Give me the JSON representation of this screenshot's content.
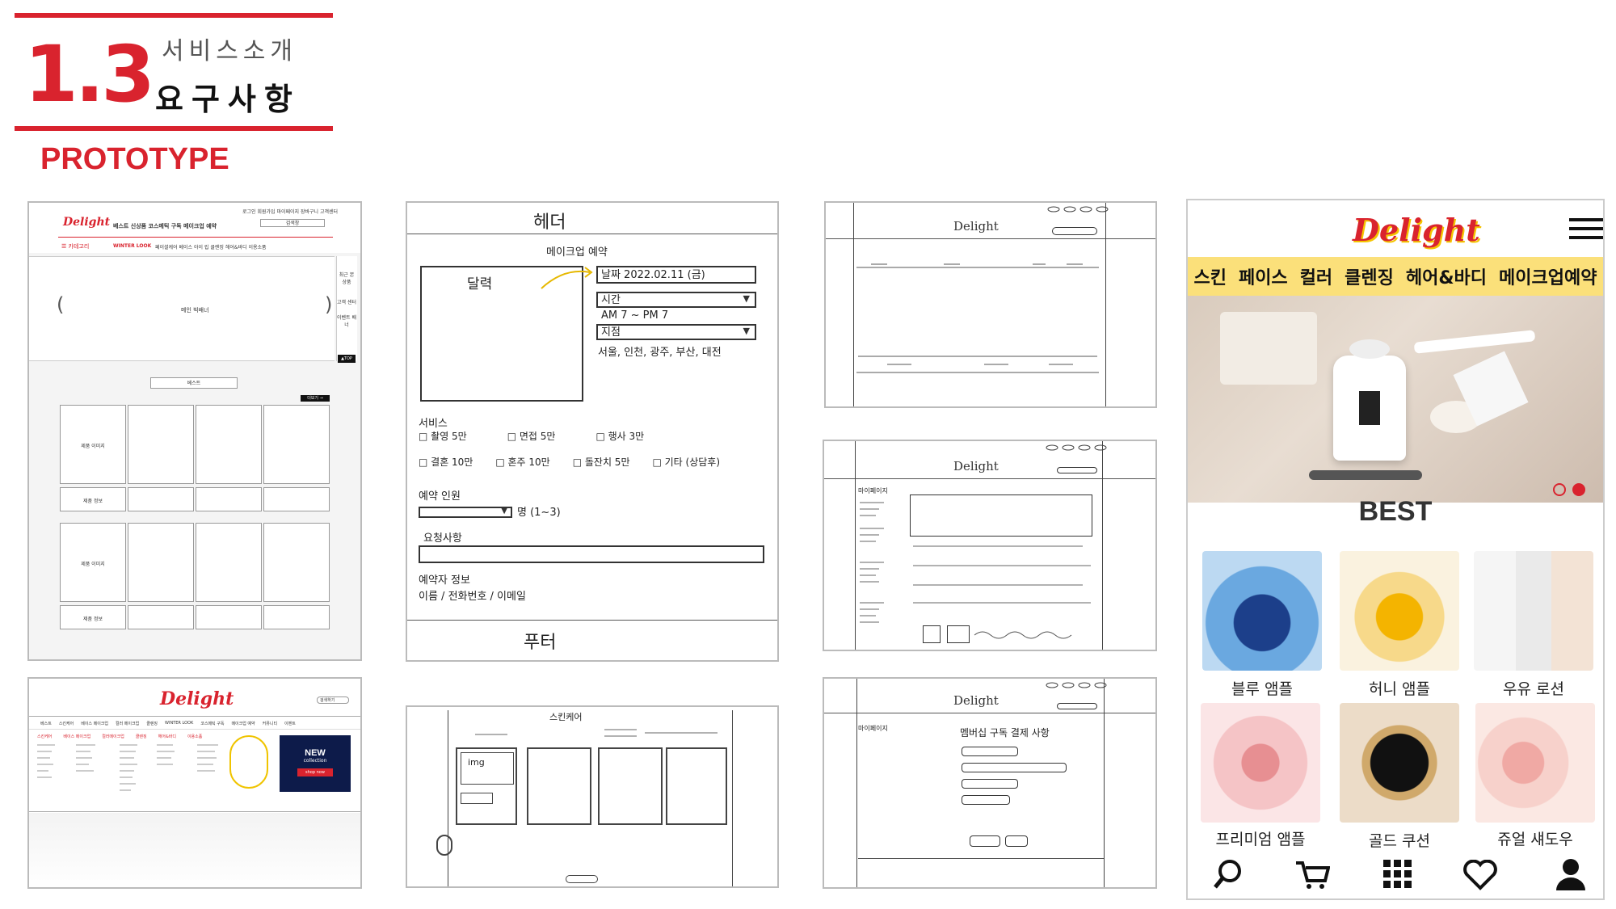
{
  "header": {
    "section_number": "1.3",
    "subtitle": "서비스소개",
    "title": "요구사항",
    "label": "PROTOTYPE"
  },
  "colors": {
    "accent": "#d9232e",
    "banner_yellow": "#fbe07a"
  },
  "desktop_main": {
    "logo": "Delight",
    "top_links": "로그인 회원가입 마이페이지 장바구니 고객센터",
    "nav": "베스트  신상품  코스메틱 구독  메이크업 예약",
    "search_label": "검색창",
    "category_label": "카테고리",
    "sub_nav_first": "WINTER LOOK",
    "sub_nav": "페이셜케어 베이스 아이 립 클렌징 헤어&바디 이용소품",
    "banner": "메인 빅배너",
    "side_items": [
      "최근 본 상품",
      "고객 센터",
      "이벤트 배너"
    ],
    "top_button": "▲TOP",
    "best_label": "베스트",
    "more_label": "더보기 →",
    "product_image": "제품 이미지",
    "product_info": "제품 정보"
  },
  "desktop_menu": {
    "logo": "Delight",
    "search_placeholder": "검색하기",
    "nav": [
      "베스트",
      "스킨케어",
      "베이스 메이크업",
      "컬러 메이크업",
      "클렌징",
      "WINTER LOOK",
      "코스메틱 구독",
      "메이크업 예약",
      "커뮤니티",
      "이벤트"
    ],
    "columns": [
      "스킨케어",
      "베이스 메이크업",
      "컬러메이크업",
      "클렌징",
      "헤어&바디",
      "이용소품"
    ],
    "promo_title": "NEW",
    "promo_sub": "collection",
    "promo_button": "shop now"
  },
  "reservation_sketch": {
    "header": "헤더",
    "title": "메이크업 예약",
    "calendar": "달력",
    "date": "날짜  2022.02.11 (금)",
    "time": "시간",
    "time_range": "AM 7 ~ PM 7",
    "branch": "지점",
    "branches": "서울, 인천, 광주, 부산, 대전",
    "service_label": "서비스",
    "services_row1": [
      "□ 촬영 5만",
      "□ 면접 5만",
      "□ 행사 3만"
    ],
    "services_row2": [
      "□ 결혼 10만",
      "□ 혼주 10만",
      "□ 돌잔치 5만",
      "□ 기타 (상담후)"
    ],
    "people_label": "예약 인원",
    "people_suffix": "명  (1~3)",
    "request_label": "요청사항",
    "booker_label": "예약자 정보",
    "booker_fields": "이름  /  전화번호  /  이메일",
    "footer": "푸터"
  },
  "list_sketch": {
    "title": "스킨케어",
    "img": "img"
  },
  "sketch_logo": "Delight",
  "mypage_label": "마이페이지",
  "subscription_sketch": {
    "title": "멤버십 구독 결제 사항"
  },
  "mobile": {
    "logo": "Delight",
    "categories": [
      "스킨",
      "페이스",
      "컬러",
      "클렌징",
      "헤어&바디",
      "메이크업예약"
    ],
    "best_title": "BEST",
    "products": [
      "블루 앰플",
      "허니 앰플",
      "우유 로션",
      "프리미엄 앰플",
      "골드 쿠션",
      "쥬얼 섀도우"
    ],
    "nav_icons": [
      "search-icon",
      "cart-icon",
      "grid-icon",
      "heart-icon",
      "user-icon"
    ]
  }
}
